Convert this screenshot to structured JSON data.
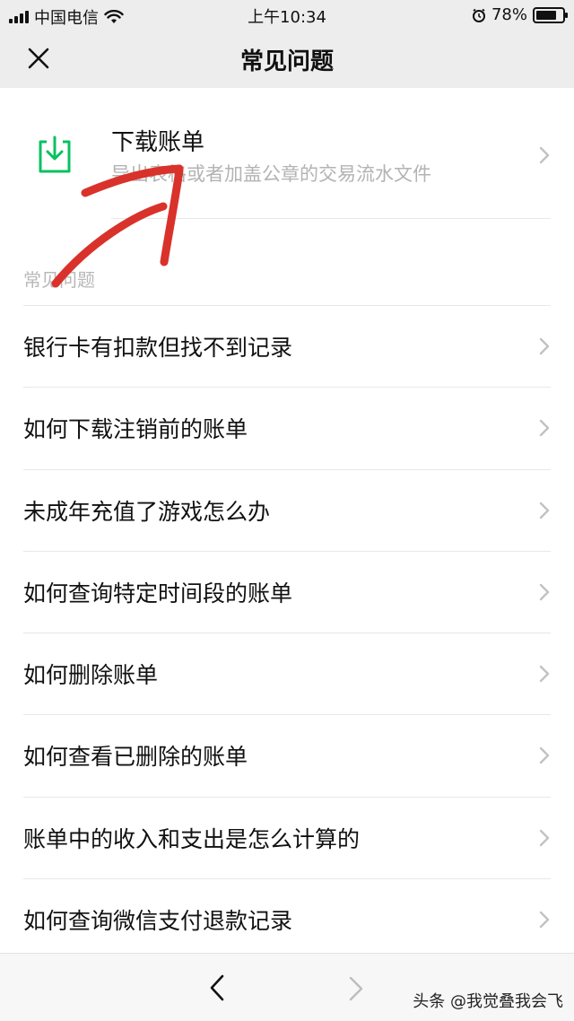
{
  "status_bar": {
    "carrier": "中国电信",
    "time": "上午10:34",
    "battery_percent": "78%",
    "battery_level": 0.78
  },
  "nav": {
    "title": "常见问题",
    "close_icon": "close-icon"
  },
  "download_card": {
    "title": "下载账单",
    "subtitle": "导出表格或者加盖公章的交易流水文件",
    "icon": "download-icon",
    "accent_color": "#07c160"
  },
  "section": {
    "label": "常见问题"
  },
  "faq": [
    {
      "label": "银行卡有扣款但找不到记录"
    },
    {
      "label": "如何下载注销前的账单"
    },
    {
      "label": "未成年充值了游戏怎么办"
    },
    {
      "label": "如何查询特定时间段的账单"
    },
    {
      "label": "如何删除账单"
    },
    {
      "label": "如何查看已删除的账单"
    },
    {
      "label": "账单中的收入和支出是怎么计算的"
    },
    {
      "label": "如何查询微信支付退款记录"
    }
  ],
  "toolbar": {
    "back_icon": "chevron-left-icon",
    "forward_icon": "chevron-right-icon"
  },
  "watermark": "头条 @我觉叠我会飞",
  "annotation": {
    "type": "hand-drawn arrow",
    "color": "#d9322b"
  }
}
